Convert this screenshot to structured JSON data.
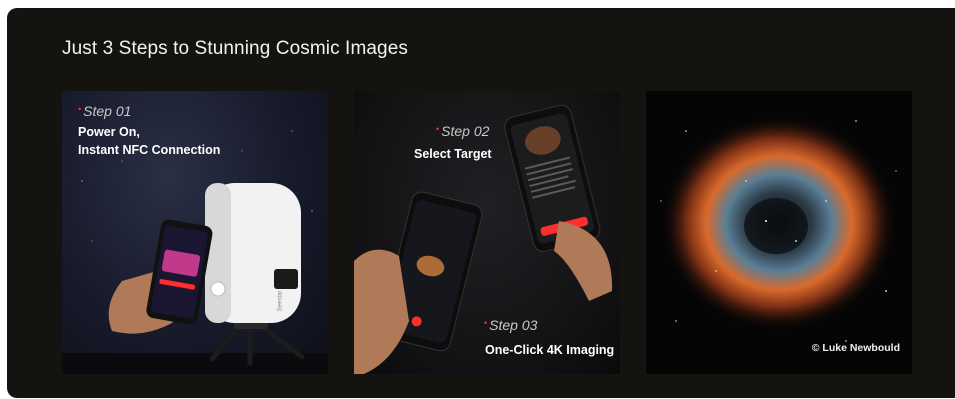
{
  "section": {
    "title": "Just 3 Steps to Stunning Cosmic Images"
  },
  "cards": [
    {
      "step": "Step 01",
      "lines": [
        "Power On,",
        "Instant NFC Connection"
      ]
    },
    {
      "step_a": "Step 02",
      "text_a": "Select  Target",
      "step_b": "Step 03",
      "text_b": "One-Click 4K Imaging"
    },
    {
      "credit": "© Luke Newbould"
    }
  ],
  "device": {
    "brand": "Seestar"
  },
  "colors": {
    "accent": "#ff2d2d",
    "background": "#141310",
    "nebula": "#d9692c"
  }
}
